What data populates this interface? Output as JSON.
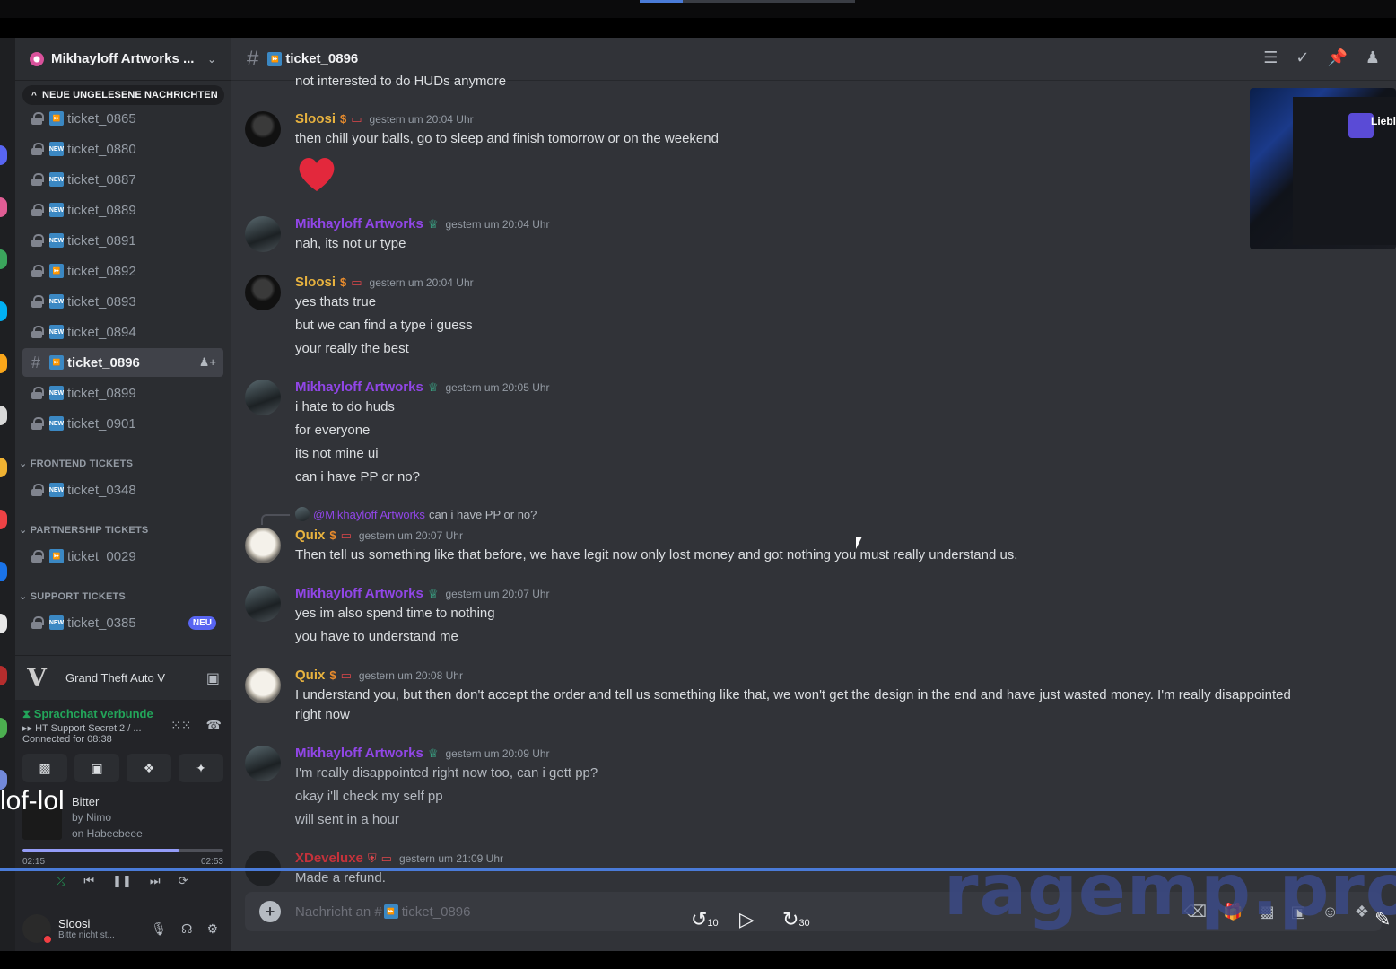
{
  "server": {
    "name": "Mikhayloff Artworks ...",
    "unread_pill": "NEUE UNGELESENE NACHRICHTEN"
  },
  "channels": [
    {
      "name": "ticket_0865",
      "icon": "fast-forward-emoji"
    },
    {
      "name": "ticket_0880",
      "icon": "new-emoji"
    },
    {
      "name": "ticket_0887",
      "icon": "new-emoji"
    },
    {
      "name": "ticket_0889",
      "icon": "new-emoji"
    },
    {
      "name": "ticket_0891",
      "icon": "new-emoji"
    },
    {
      "name": "ticket_0892",
      "icon": "fast-forward-emoji"
    },
    {
      "name": "ticket_0893",
      "icon": "new-emoji"
    },
    {
      "name": "ticket_0894",
      "icon": "new-emoji"
    },
    {
      "name": "ticket_0896",
      "icon": "fast-forward-emoji",
      "active": true
    },
    {
      "name": "ticket_0899",
      "icon": "new-emoji"
    },
    {
      "name": "ticket_0901",
      "icon": "new-emoji"
    }
  ],
  "categories": {
    "frontend": {
      "label": "FRONTEND TICKETS",
      "channel": "ticket_0348"
    },
    "partnership": {
      "label": "PARTNERSHIP TICKETS",
      "channel": "ticket_0029"
    },
    "support": {
      "label": "SUPPORT TICKETS",
      "channel": "ticket_0385",
      "badge": "NEU"
    }
  },
  "activity": {
    "name": "Grand Theft Auto V"
  },
  "voice": {
    "status": "Sprachchat verbunde",
    "channel": "HT Support Secret 2 / ...",
    "connected": "Connected for 08:38"
  },
  "music": {
    "title": "Bitter",
    "artist": "by Nimo",
    "album": "on Habeebeee",
    "elapsed": "02:15",
    "duration": "02:53",
    "progress": 0.78
  },
  "user": {
    "name": "Sloosi",
    "status": "Bitte nicht st..."
  },
  "header": {
    "channel_name": "ticket_0896"
  },
  "messages": {
    "older_line": "not interested to do HUDs anymore",
    "m1": {
      "author": "Sloosi",
      "time": "gestern um 20:04 Uhr",
      "lines": [
        "then chill your balls, go to sleep and finish tomorrow or on the weekend"
      ]
    },
    "m2": {
      "author": "Mikhayloff Artworks",
      "time": "gestern um 20:04 Uhr",
      "lines": [
        "nah, its not ur type"
      ]
    },
    "m3": {
      "author": "Sloosi",
      "time": "gestern um 20:04 Uhr",
      "lines": [
        "yes thats true",
        "but we can find a type i guess",
        "your really the best"
      ]
    },
    "m4": {
      "author": "Mikhayloff Artworks",
      "time": "gestern um 20:05 Uhr",
      "lines": [
        "i hate to do huds",
        "for everyone",
        "its not mine ui",
        "can i have PP or no?"
      ]
    },
    "m5": {
      "reply_mention": "@Mikhayloff Artworks",
      "reply_text": "can i have PP or no?",
      "author": "Quix",
      "time": "gestern um 20:07 Uhr",
      "lines": [
        "Then tell us something like that before, we have legit now only lost money and got nothing you must really understand us."
      ]
    },
    "m6": {
      "author": "Mikhayloff Artworks",
      "time": "gestern um 20:07 Uhr",
      "lines": [
        "yes im also spend time to nothing",
        "you have to understand me"
      ]
    },
    "m7": {
      "author": "Quix",
      "time": "gestern um 20:08 Uhr",
      "lines": [
        "I understand you, but then don't accept the order and tell us something like that, we won't get the design in the end and have just wasted money. I'm really disappointed right now"
      ]
    },
    "m8": {
      "author": "Mikhayloff Artworks",
      "time": "gestern um 20:09 Uhr",
      "lines": [
        "I'm really disappointed right now too, can i gett pp?",
        "okay i'll check my self pp",
        "will sent in a hour"
      ]
    },
    "m9": {
      "author": "XDeveluxe",
      "time": "gestern um 21:09 Uhr",
      "lines": [
        "Made a refund."
      ]
    }
  },
  "composer": {
    "placeholder": "Nachricht an #",
    "channel": "ticket_0896"
  },
  "thumbnail": {
    "text": "Liebl"
  },
  "overlay": {
    "watermark": "ragemp.pro",
    "left_text": "lof-lol",
    "rewind": "10",
    "forward": "30"
  },
  "colors": {
    "accent": "#5865f2",
    "online": "#23a55a",
    "mikh_role": "#9146e7",
    "gold_role": "#e7b23f"
  }
}
